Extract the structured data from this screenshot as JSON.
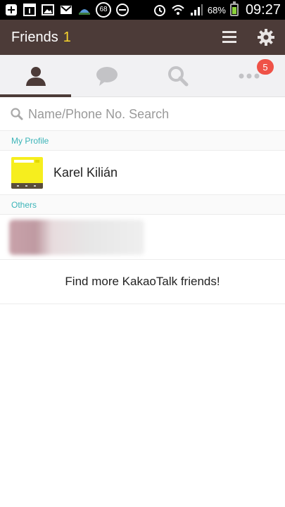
{
  "status_bar": {
    "notification_count": "68",
    "battery_percent": "68%",
    "time": "09:27",
    "icons": [
      "plus-icon",
      "calendar-icon",
      "gallery-icon",
      "gmail-icon",
      "cloud-app-icon",
      "notification-count-badge",
      "do-not-disturb-icon",
      "alarm-icon",
      "wifi-icon",
      "signal-icon",
      "battery-icon"
    ]
  },
  "app_bar": {
    "title": "Friends",
    "count": "1",
    "background": "#4c3b38",
    "count_color": "#f8d52d"
  },
  "tabs": [
    {
      "name": "friends",
      "icon": "person-icon",
      "active": true
    },
    {
      "name": "chats",
      "icon": "chat-bubble-icon",
      "active": false
    },
    {
      "name": "find",
      "icon": "search-icon",
      "active": false
    },
    {
      "name": "more",
      "icon": "more-dots-icon",
      "active": false,
      "badge": "5"
    }
  ],
  "search": {
    "placeholder": "Name/Phone No. Search",
    "value": ""
  },
  "sections": {
    "my_profile_label": "My Profile",
    "others_label": "Others"
  },
  "profile": {
    "name": "Karel Kilián"
  },
  "others": [
    {
      "name": "",
      "blurred": true
    }
  ],
  "find_more_label": "Find more KakaoTalk friends!",
  "colors": {
    "accent": "#3bb4b8",
    "badge": "#ef5247"
  }
}
